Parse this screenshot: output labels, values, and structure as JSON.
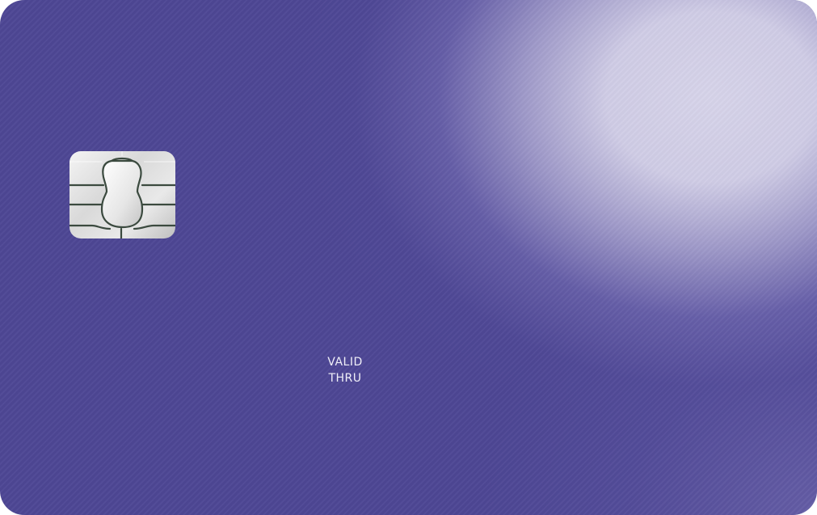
{
  "card": {
    "base_color": "#4d4694",
    "glow_color": "#d7d4ea",
    "chip_icon": "chip-icon",
    "expiry_label_line1": "VALID",
    "expiry_label_line2": "THRU"
  }
}
